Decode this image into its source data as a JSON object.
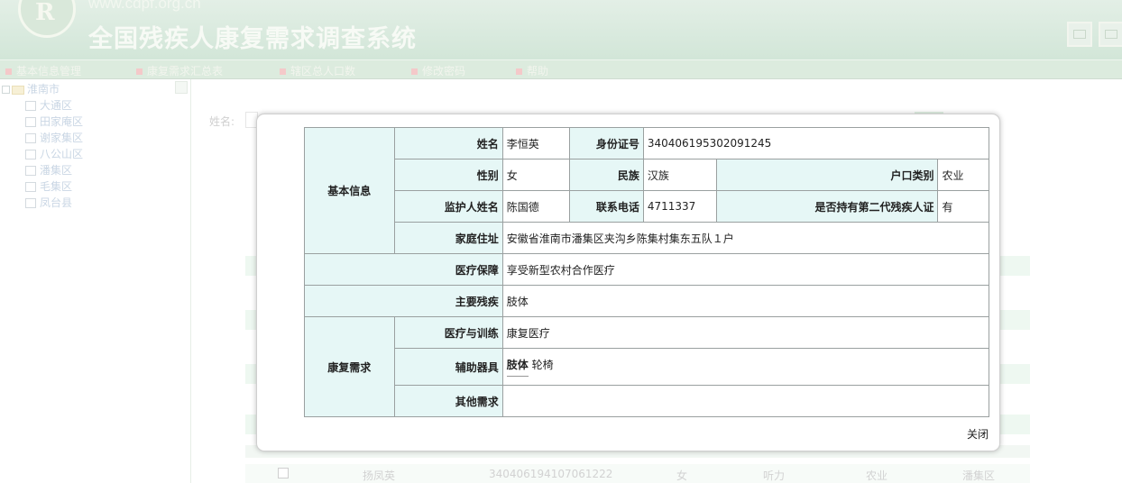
{
  "header": {
    "site_url": "www.cdpf.org.cn",
    "logo_letter": "R",
    "title": "全国残疾人康复需求调查系统",
    "icons": [
      "system-icon",
      "window-icon"
    ]
  },
  "nav": {
    "items": [
      {
        "label": "基本信息管理"
      },
      {
        "label": "康复需求汇总表"
      },
      {
        "label": "辖区总人口数"
      },
      {
        "label": "修改密码"
      },
      {
        "label": "帮助"
      }
    ]
  },
  "sidebar": {
    "root": "淮南市",
    "children": [
      "大通区",
      "田家庵区",
      "谢家集区",
      "八公山区",
      "潘集区",
      "毛集区",
      "凤台县"
    ]
  },
  "background": {
    "search_label": "姓名:",
    "row": {
      "name": "扬凤英",
      "id": "340406194107061222",
      "gender": "女",
      "disability": "听力",
      "household": "农业",
      "district": "潘集区"
    }
  },
  "modal": {
    "group_basic": "基本信息",
    "group_rehab": "康复需求",
    "name_label": "姓名",
    "name_value": "李恒英",
    "id_label": "身份证号",
    "id_value": "340406195302091245",
    "gender_label": "性别",
    "gender_value": "女",
    "ethnic_label": "民族",
    "ethnic_value": "汉族",
    "hukou_label": "户口类别",
    "hukou_value": "农业",
    "guardian_label": "监护人姓名",
    "guardian_value": "陈国德",
    "phone_label": "联系电话",
    "phone_value": "4711337",
    "cert_label": "是否持有第二代残疾人证",
    "cert_value": "有",
    "address_label": "家庭住址",
    "address_value": "安徽省淮南市潘集区夹沟乡陈集村集东五队１户",
    "medical_label": "医疗保障",
    "medical_value": "享受新型农村合作医疗",
    "disability_label": "主要残疾",
    "disability_value": "肢体",
    "treatment_label": "医疗与训练",
    "treatment_value": "康复医疗",
    "device_label": "辅助器具",
    "device_tag": "肢体",
    "device_value": "轮椅",
    "other_label": "其他需求",
    "other_value": "",
    "close_label": "关闭"
  }
}
